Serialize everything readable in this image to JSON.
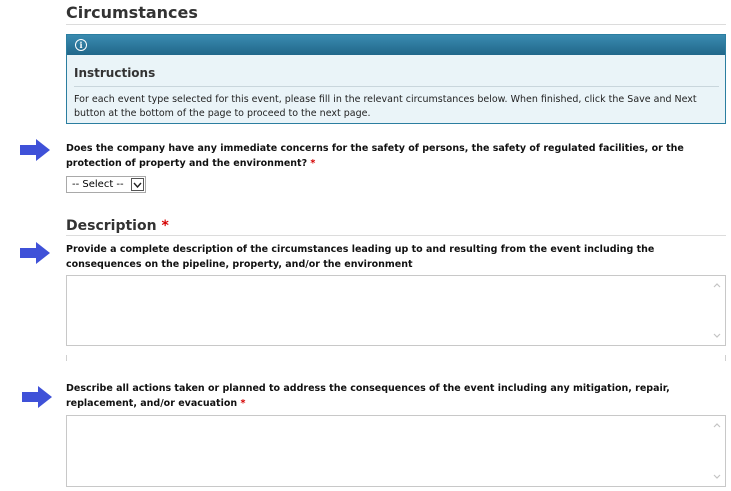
{
  "circumstances": {
    "title": "Circumstances",
    "instructions": {
      "title": "Instructions",
      "text": "For each event type selected for this event, please fill in the relevant circumstances below. When finished, click the Save and Next button at the bottom of the page to proceed to the next page."
    },
    "safety_question": {
      "label": "Does the company have any immediate concerns for the safety of persons, the safety of regulated facilities, or the protection of property and the environment?",
      "required_mark": "*",
      "select_value": "-- Select --"
    }
  },
  "description": {
    "title": "Description",
    "required_mark": "*",
    "circumstances_field": {
      "label": "Provide a complete description of the circumstances leading up to and resulting from the event including the consequences on the pipeline, property, and/or the environment",
      "value": ""
    },
    "actions_field": {
      "label": "Describe all actions taken or planned to address the consequences of the event including any mitigation, repair, replacement, and/or evacuation",
      "required_mark": "*",
      "value": ""
    }
  },
  "colors": {
    "arrow": "#3f51d8",
    "panel_header": "#2a7597",
    "panel_bg": "#eaf4f8",
    "required": "#d40000"
  }
}
